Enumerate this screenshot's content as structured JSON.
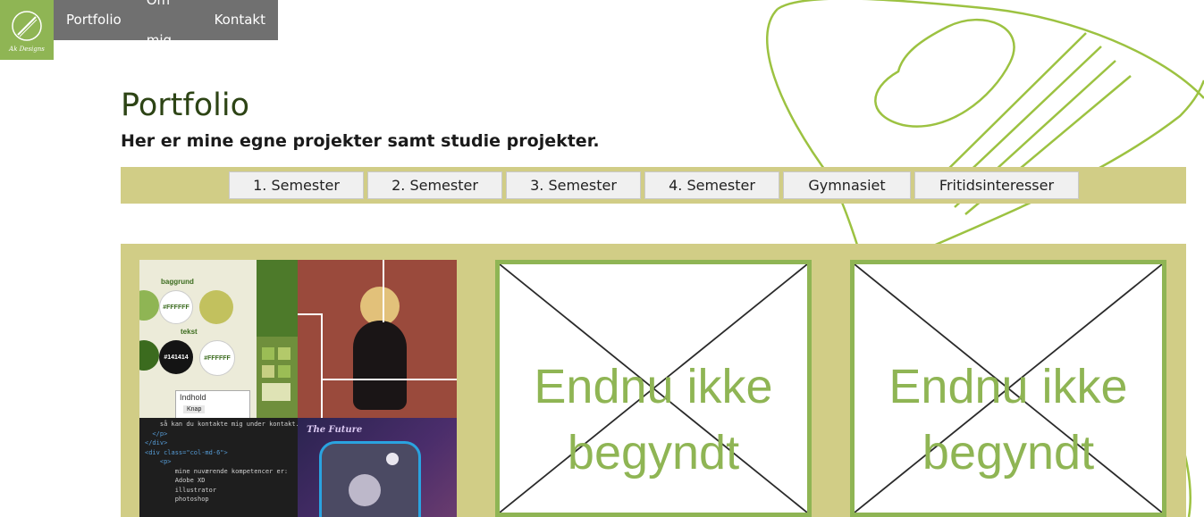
{
  "nav": {
    "logo_alt": "Ak Designs",
    "items": [
      {
        "label": "Portfolio"
      },
      {
        "label": "Om mig"
      },
      {
        "label": "Kontakt"
      }
    ]
  },
  "header": {
    "title": "Portfolio",
    "subtitle": "Her er mine egne projekter samt studie projekter."
  },
  "semesters": [
    {
      "label": "1. Semester"
    },
    {
      "label": "2. Semester"
    },
    {
      "label": "3. Semester"
    },
    {
      "label": "4. Semester"
    },
    {
      "label": "Gymnasiet"
    },
    {
      "label": "Fritidsinteresser"
    }
  ],
  "projects": {
    "collage": {
      "palette_label_bg": "baggrund",
      "palette_label_text": "tekst",
      "swatch_1": "#FFFFFF",
      "swatch_2": "#141414",
      "swatch_3": "#FFFFFF",
      "box_title": "Indhold",
      "box_button": "Knap",
      "poster_title": "The Future",
      "code_lines": [
        "    så kan du kontakte mig under kontakt.",
        "  </p>",
        "</div>",
        "<div class=\"col-md-6\">",
        "    <p>",
        "        mine nuværende kompetencer er:",
        "",
        "        Adobe XD",
        "        illustrator",
        "        photoshop"
      ]
    },
    "placeholder_1": {
      "line1": "Endnu ikke",
      "line2": "begyndt"
    },
    "placeholder_2": {
      "line1": "Endnu ikke",
      "line2": "begyndt"
    }
  },
  "colors": {
    "accent_green": "#8fb554",
    "bar_olive": "#d1cd86",
    "nav_gray": "#707070",
    "title_green": "#2d4415"
  }
}
